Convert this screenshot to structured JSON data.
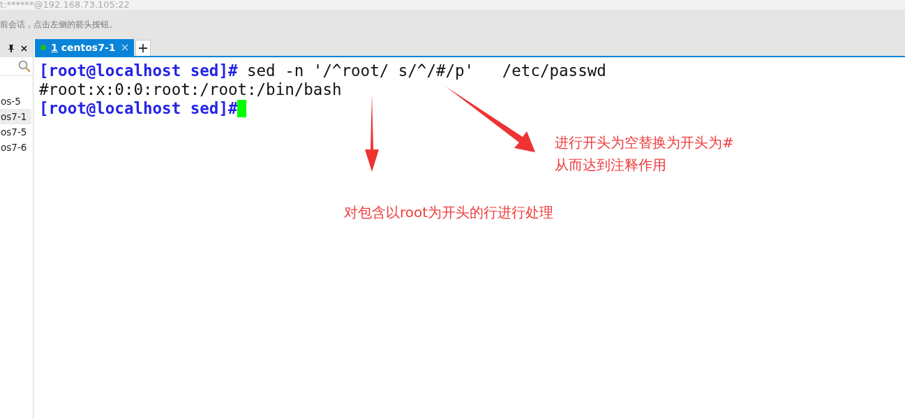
{
  "title_bar": {
    "text": "t:******@192.168.73.105:22"
  },
  "info_bar": {
    "text": "前会话，点击左侧的箭头按钮。"
  },
  "sidebar": {
    "items": [
      {
        "label": "os-5",
        "selected": false
      },
      {
        "label": "os7-1",
        "selected": true
      },
      {
        "label": "os7-5",
        "selected": false
      },
      {
        "label": "os7-6",
        "selected": false
      }
    ]
  },
  "tabs": [
    {
      "number": "1",
      "label": "centos7-1",
      "connected": true,
      "selected": true
    }
  ],
  "terminal": {
    "lines": [
      {
        "kind": "prompt",
        "prompt": "[root@localhost sed]#",
        "command": " sed -n '/^root/ s/^/#/p'   /etc/passwd",
        "cursor": false
      },
      {
        "kind": "output",
        "text": "#root:x:0:0:root:/root:/bin/bash"
      },
      {
        "kind": "prompt",
        "prompt": "[root@localhost sed]#",
        "cursor": true
      }
    ]
  },
  "annotations": [
    {
      "kind": "note-right",
      "lines": [
        "进行开头为空替换为开头为#",
        "从而达到注释作用"
      ]
    },
    {
      "kind": "note-bottom",
      "lines": [
        "对包含以root为开头的行进行处理"
      ]
    }
  ]
}
